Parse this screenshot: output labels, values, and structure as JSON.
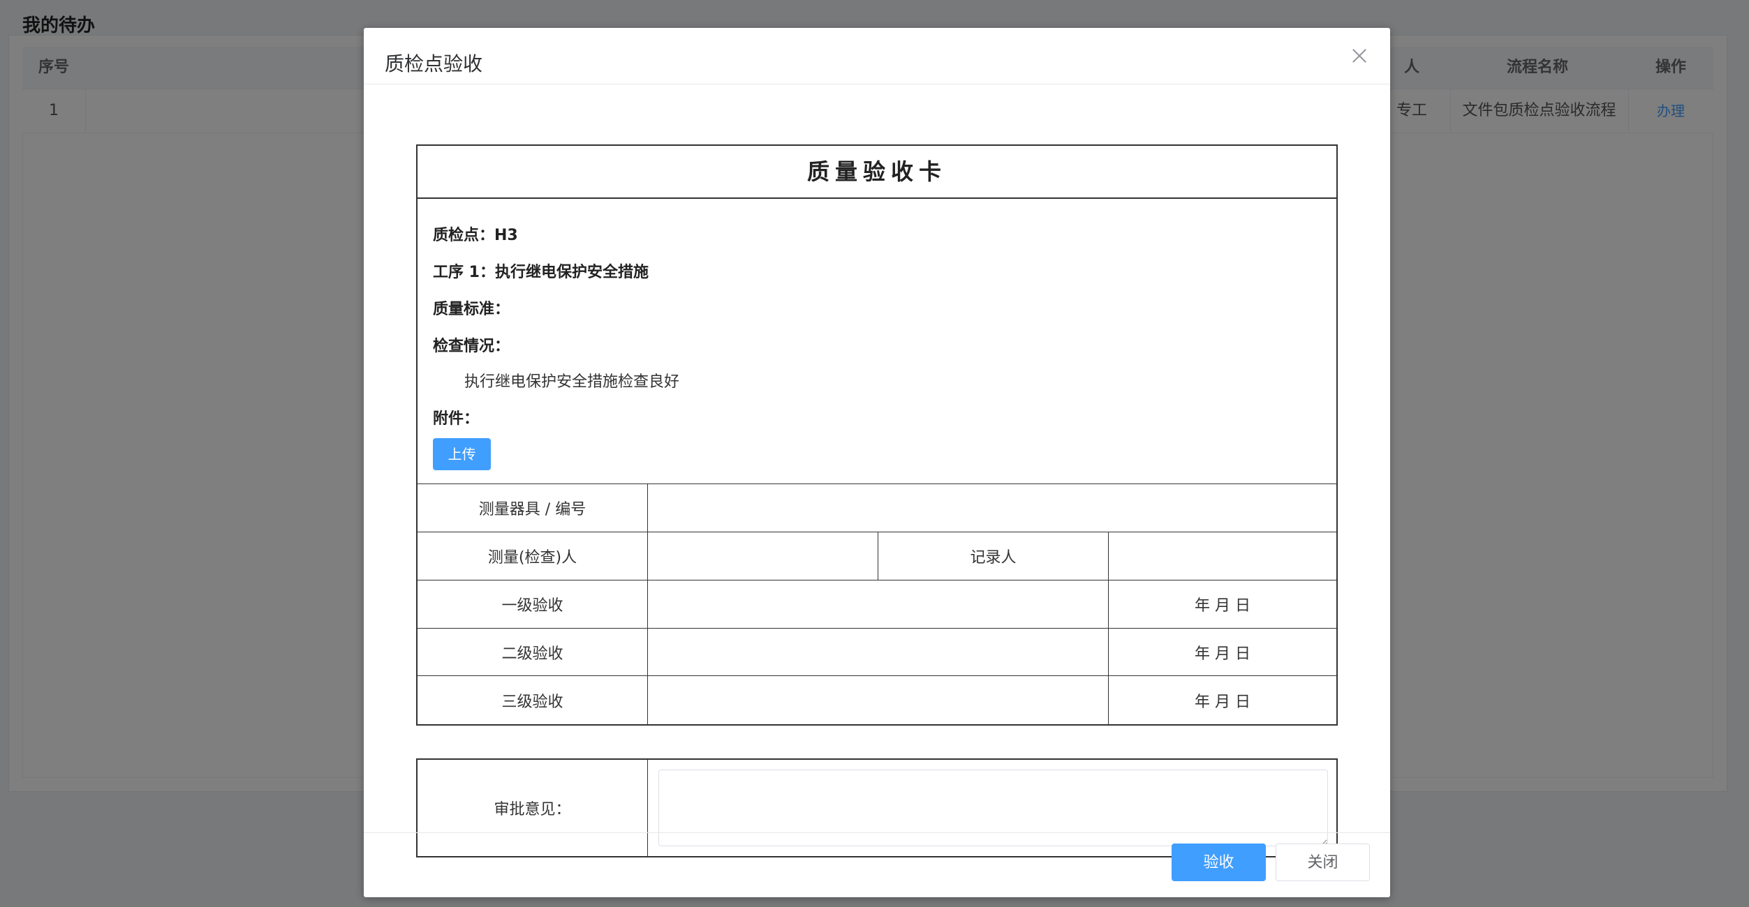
{
  "page": {
    "title": "我的待办",
    "table": {
      "headers": {
        "index": "序号",
        "handler": "人",
        "process_name": "流程名称",
        "action": "操作"
      },
      "rows": [
        {
          "index": "1",
          "handler": "专工",
          "process_name": "文件包质检点验收流程",
          "action": "办理"
        }
      ]
    }
  },
  "dialog": {
    "title": "质检点验收",
    "card": {
      "title": "质量验收卡",
      "checkpoint": "质检点：H3",
      "procedure": "工序 1：执行继电保护安全措施",
      "quality_standard": "质量标准：",
      "inspection_label": "检查情况：",
      "inspection_text": "执行继电保护安全措施检查良好",
      "attachment_label": "附件：",
      "upload_label": "上传",
      "measure_tool_label": "测量器具 / 编号",
      "measure_person_label": "测量(检查)人",
      "recorder_label": "记录人",
      "level1_label": "一级验收",
      "level2_label": "二级验收",
      "level3_label": "三级验收",
      "date_placeholder": "年 月 日",
      "approval_label": "审批意见："
    },
    "buttons": {
      "accept": "验收",
      "close": "关闭"
    }
  }
}
